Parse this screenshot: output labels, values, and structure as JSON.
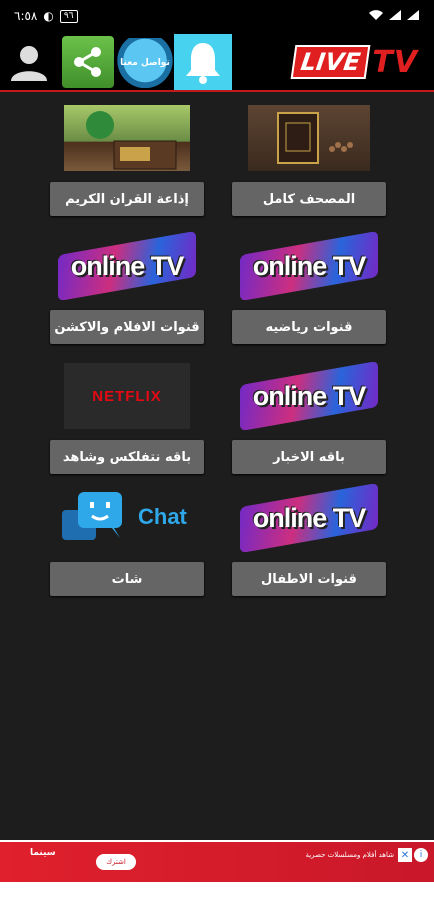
{
  "status_bar": {
    "time": "٦:٥٨",
    "battery": "٩٦"
  },
  "header": {
    "badge_text": "تواصل معنا",
    "logo_live": "LIVE",
    "logo_tv": "TV"
  },
  "tiles": [
    {
      "label": "المصحف كامل",
      "image": "quran-book"
    },
    {
      "label": "إذاعة القران الكريم",
      "image": "quran-radio"
    },
    {
      "label": "قنوات رياضيه",
      "image": "online-tv",
      "image_text": "online TV"
    },
    {
      "label": "قنوات الافلام والاكشن",
      "image": "online-tv",
      "image_text": "online TV"
    },
    {
      "label": "باقه الاخبار",
      "image": "online-tv",
      "image_text": "online TV"
    },
    {
      "label": "باقه نتفلكس وشاهد",
      "image": "netflix",
      "image_text": "NETFLIX"
    },
    {
      "label": "قنوات الاطفال",
      "image": "online-tv",
      "image_text": "online TV"
    },
    {
      "label": "شات",
      "image": "chat",
      "image_text": "Chat"
    }
  ],
  "ad": {
    "brand": "سينما",
    "button": "اشترك",
    "text": "شاهد أفلام ومسلسلات حصرية"
  },
  "colors": {
    "accent_red": "#e02020",
    "tile_gray": "#656565",
    "bell_bg": "#47d3f0"
  }
}
